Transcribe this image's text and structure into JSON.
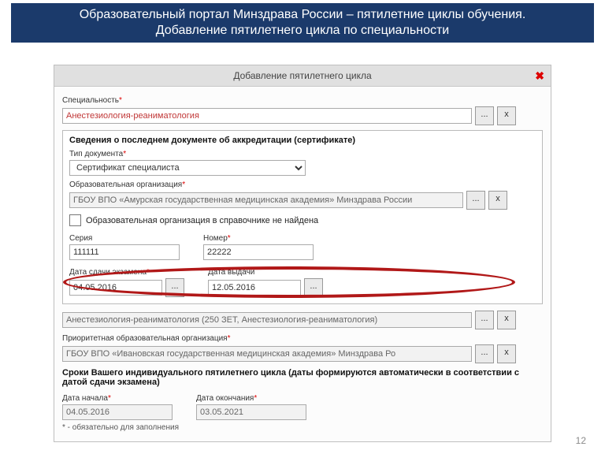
{
  "slide": {
    "title_line1": "Образовательный портал Минздрава России – пятилетние циклы обучения.",
    "title_line2": "Добавление пятилетнего цикла по специальности",
    "page_number": "12"
  },
  "modal": {
    "title": "Добавление пятилетнего цикла",
    "close": "✖",
    "specialty_label": "Специальность",
    "specialty_value": "Анестезиология-реаниматология",
    "btn_pick": "...",
    "btn_clear": "x",
    "section_title": "Сведения о последнем документе об аккредитации (сертификате)",
    "doc_type_label": "Тип документа",
    "doc_type_value": "Сертификат специалиста",
    "edu_org_label": "Образовательная организация",
    "edu_org_value": "ГБОУ ВПО «Амурская государственная медицинская академия» Минздрава России",
    "chk_label": "Образовательная организация в справочнике не найдена",
    "series_label": "Серия",
    "series_value": "111111",
    "number_label": "Номер",
    "number_value": "22222",
    "exam_date_label": "Дата сдачи экзамена",
    "exam_date_value": "04.05.2016",
    "issue_date_label": "Дата выдачи",
    "issue_date_value": "12.05.2016",
    "program_value": "Анестезиология-реаниматология (250 ЗЕТ, Анестезиология-реаниматология)",
    "priority_org_label": "Приоритетная образовательная организация",
    "priority_org_value": "ГБОУ ВПО «Ивановская государственная медицинская академия» Минздрава Ро",
    "cycle_dates_title": "Сроки Вашего индивидуального пятилетнего цикла (даты формируются автоматически в соответствии с датой сдачи экзамена)",
    "start_label": "Дата начала",
    "start_value": "04.05.2016",
    "end_label": "Дата окончания",
    "end_value": "03.05.2021",
    "footnote": "* - обязательно для заполнения"
  }
}
